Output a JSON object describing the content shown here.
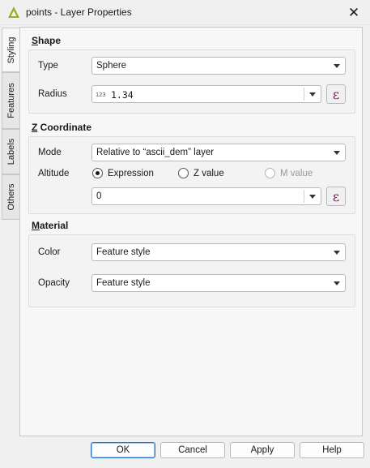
{
  "window": {
    "title": "points - Layer Properties"
  },
  "tabs": [
    {
      "label": "Styling",
      "active": true
    },
    {
      "label": "Features",
      "active": false
    },
    {
      "label": "Labels",
      "active": false
    },
    {
      "label": "Others",
      "active": false
    }
  ],
  "shape": {
    "title_first": "S",
    "title_rest": "hape",
    "type_label": "Type",
    "type_value": "Sphere",
    "radius_label": "Radius",
    "radius_badge": "123",
    "radius_value": "1.34",
    "expression_icon": "ε"
  },
  "z_coordinate": {
    "title_first": "Z",
    "title_rest": " Coordinate",
    "mode_label": "Mode",
    "mode_value": "Relative to “ascii_dem” layer",
    "altitude_label": "Altitude",
    "options": [
      {
        "label": "Expression",
        "selected": true,
        "enabled": true
      },
      {
        "label": "Z value",
        "selected": false,
        "enabled": true
      },
      {
        "label": "M value",
        "selected": false,
        "enabled": false
      }
    ],
    "altitude_value": "0",
    "expression_icon": "ε"
  },
  "material": {
    "title_first": "M",
    "title_rest": "aterial",
    "color_label": "Color",
    "color_value": "Feature style",
    "opacity_label": "Opacity",
    "opacity_value": "Feature style"
  },
  "buttons": {
    "ok": "OK",
    "cancel": "Cancel",
    "apply": "Apply",
    "help": "Help"
  },
  "colors": {
    "accent": "#2a74c8",
    "qgis_green": "#93b023",
    "epsilon": "#7a1e60"
  }
}
